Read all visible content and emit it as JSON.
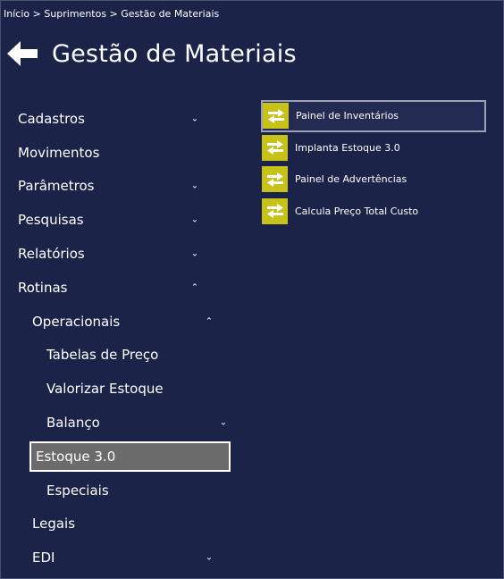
{
  "breadcrumb": "Início > Suprimentos > Gestão de Materiais",
  "header": {
    "title": "Gestão de Materiais",
    "back_icon": "arrow-left-icon"
  },
  "sidebar": {
    "items": [
      {
        "label": "Cadastros",
        "level": 0,
        "chevron": "down"
      },
      {
        "label": "Movimentos",
        "level": 0,
        "chevron": "none"
      },
      {
        "label": "Parâmetros",
        "level": 0,
        "chevron": "down"
      },
      {
        "label": "Pesquisas",
        "level": 0,
        "chevron": "down"
      },
      {
        "label": "Relatórios",
        "level": 0,
        "chevron": "down"
      },
      {
        "label": "Rotinas",
        "level": 0,
        "chevron": "up"
      },
      {
        "label": "Operacionais",
        "level": 1,
        "chevron": "up"
      },
      {
        "label": "Tabelas de Preço",
        "level": 2,
        "chevron": "none"
      },
      {
        "label": "Valorizar Estoque",
        "level": 2,
        "chevron": "none"
      },
      {
        "label": "Balanço",
        "level": 2,
        "chevron": "down"
      },
      {
        "label": "Estoque 3.0",
        "level": 2,
        "chevron": "none",
        "selected": true
      },
      {
        "label": "Especiais",
        "level": 2,
        "chevron": "none"
      },
      {
        "label": "Legais",
        "level": 1,
        "chevron": "none"
      },
      {
        "label": "EDI",
        "level": 1,
        "chevron": "down"
      }
    ]
  },
  "actions": {
    "icon": "swap-arrows-icon",
    "tile_color": "#c6c21a",
    "items": [
      {
        "label": "Painel de Inventários",
        "focused": true
      },
      {
        "label": "Implanta Estoque 3.0"
      },
      {
        "label": "Painel de Advertências"
      },
      {
        "label": "Calcula Preço Total Custo"
      }
    ]
  },
  "colors": {
    "background": "#1b2348",
    "selected_item": "#6b6b6b",
    "text": "#ffffff"
  }
}
